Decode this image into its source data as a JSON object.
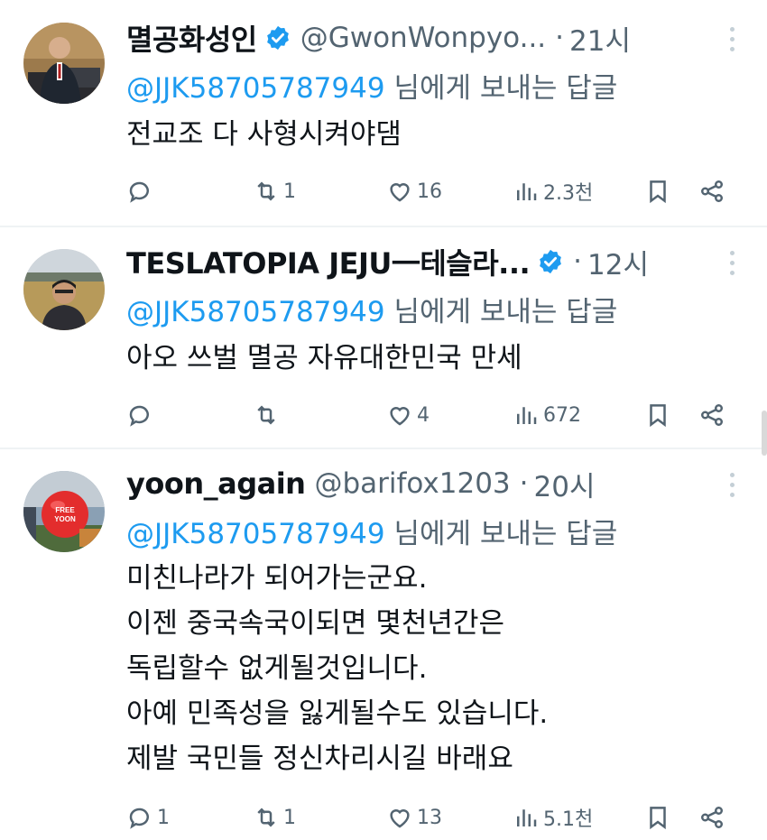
{
  "replying_to_label": "님에게 보내는 답글",
  "tweets": [
    {
      "name": "멸공화성인",
      "handle": "@GwonWonpyo...",
      "time": "21시",
      "mention": "@JJK58705787949",
      "body": [
        "전교조 다 사형시켜야댐"
      ],
      "reply_count": "",
      "retweet_count": "1",
      "like_count": "16",
      "view_count": "2.3천"
    },
    {
      "name": "TESLATOPIA JEJU一테슬라...",
      "handle": "",
      "time": "12시",
      "mention": "@JJK58705787949",
      "body": [
        "아오 쓰벌 멸공 자유대한민국 만세"
      ],
      "reply_count": "",
      "retweet_count": "",
      "like_count": "4",
      "view_count": "672"
    },
    {
      "name": "yoon_again",
      "handle": "@barifox1203",
      "time": "20시",
      "mention": "@JJK58705787949",
      "body": [
        "미친나라가 되어가는군요.",
        "이젠 중국속국이되면 몇천년간은",
        "독립할수 없게될것입니다.",
        "아예 민족성을 잃게될수도 있습니다.",
        "제발 국민들 정신차리시길 바래요"
      ],
      "reply_count": "1",
      "retweet_count": "1",
      "like_count": "13",
      "view_count": "5.1천",
      "avatar_text": "FREE YOON"
    }
  ],
  "colors": {
    "accent": "#1d9bf0",
    "secondary_text": "#536471",
    "primary_text": "#0f1419",
    "divider": "#eff3f4"
  },
  "icons": [
    "verified-badge-icon",
    "more-icon",
    "reply-icon",
    "retweet-icon",
    "like-icon",
    "views-icon",
    "bookmark-icon",
    "share-icon"
  ]
}
